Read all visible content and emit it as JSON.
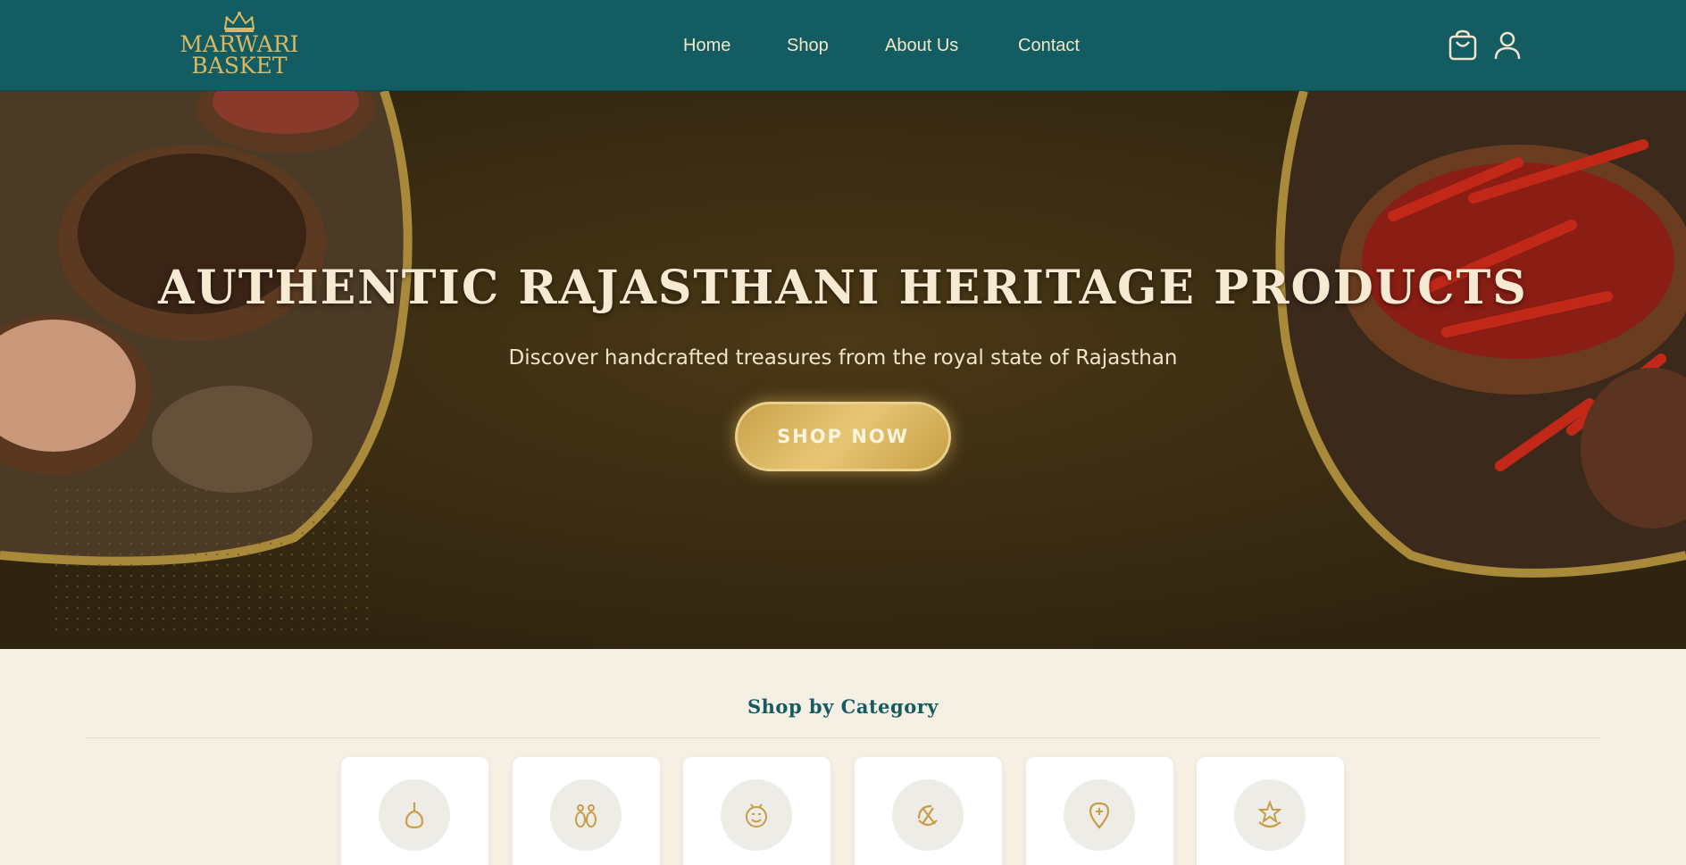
{
  "header": {
    "logo": {
      "line1": "MARWARI",
      "line2": "BASKET"
    },
    "nav": [
      {
        "label": "Home"
      },
      {
        "label": "Shop"
      },
      {
        "label": "About Us"
      },
      {
        "label": "Contact"
      }
    ],
    "icons": [
      "shopping-bag-icon",
      "user-icon"
    ]
  },
  "hero": {
    "title": "AUTHENTIC RAJASTHANI HERITAGE PRODUCTS",
    "subtitle": "Discover handcrafted treasures from the royal state of Rajasthan",
    "cta": "SHOP NOW"
  },
  "categories": {
    "title": "Shop by Category",
    "items": [
      {
        "icon": "hand-icon"
      },
      {
        "icon": "earrings-icon"
      },
      {
        "icon": "face-icon"
      },
      {
        "icon": "wheel-icon"
      },
      {
        "icon": "pin-icon"
      },
      {
        "icon": "star-hand-icon"
      }
    ]
  },
  "colors": {
    "header_bg": "#135d62",
    "gold": "#d9b864",
    "hero_bg": "#3a2c12",
    "section_bg": "#f6efe3",
    "title_teal": "#155c60"
  }
}
